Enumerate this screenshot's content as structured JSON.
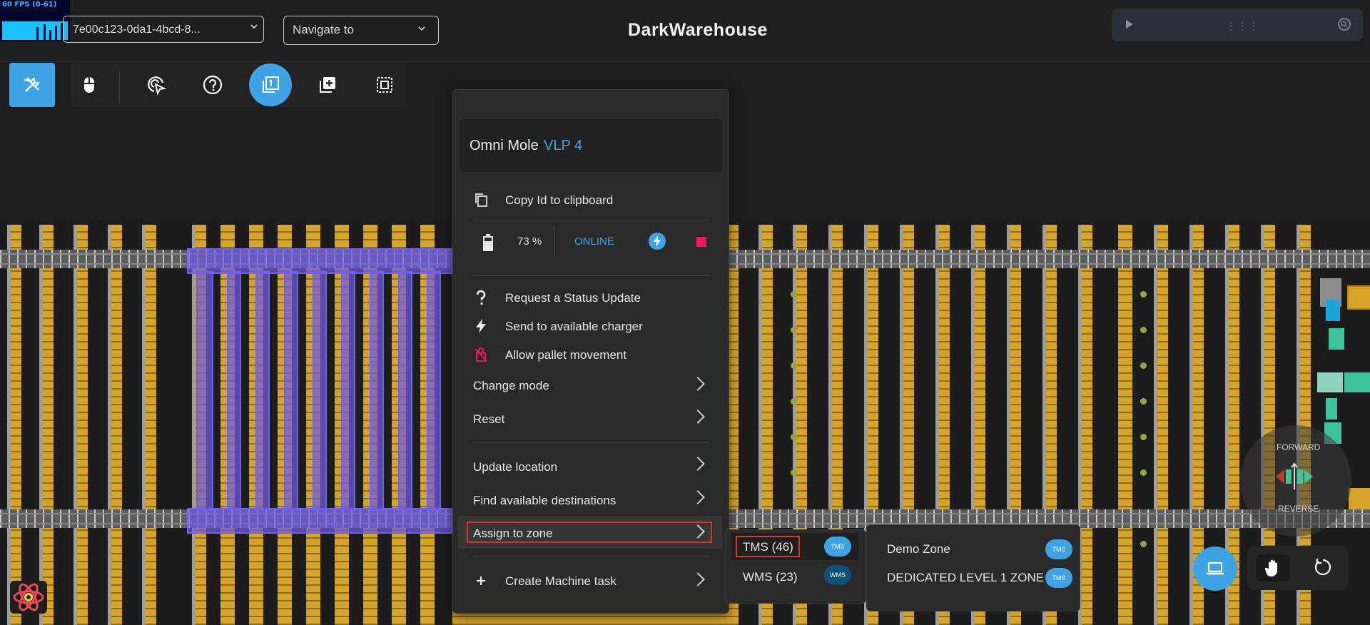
{
  "fps_monitor": {
    "label": "60 FPS (0-61)"
  },
  "header": {
    "machine_id_select": "7e00c123-0da1-4bcd-8...",
    "navigate_select": "Navigate to",
    "app_title": "DarkWarehouse"
  },
  "toolbar": {
    "icons": [
      "tools-icon",
      "mouse-icon",
      "cursor-click-icon",
      "help-icon",
      "layer-one-icon",
      "add-layer-icon",
      "select-area-icon"
    ]
  },
  "context_menu": {
    "machine_type": "Omni Mole",
    "machine_name": "VLP 4",
    "copy_id": "Copy Id to clipboard",
    "battery_pct": "73 %",
    "connection": "ONLINE",
    "items": {
      "request_status": "Request a Status Update",
      "send_charger": "Send to available charger",
      "allow_pallet": "Allow pallet movement",
      "change_mode": "Change mode",
      "reset": "Reset",
      "update_location": "Update location",
      "find_destinations": "Find available destinations",
      "assign_zone": "Assign to zone",
      "create_task": "Create Machine task"
    }
  },
  "zone_source_menu": {
    "tms": {
      "label": "TMS (46)",
      "badge": "TMS"
    },
    "wms": {
      "label": "WMS (23)",
      "badge": "WMS"
    }
  },
  "zone_list_menu": {
    "zones": [
      {
        "label": "Demo Zone",
        "badge": "TMS"
      },
      {
        "label": "DEDICATED LEVEL 1 ZONE",
        "badge": "TMS"
      }
    ]
  },
  "direction_control": {
    "forward": "FORWARD",
    "reverse": "REVERSE"
  },
  "colors": {
    "accent": "#3fa4e6",
    "highlight": "#d03a2c",
    "rack": "#d7a328",
    "selection": "#6f63e8",
    "stop": "#ea1a55"
  }
}
